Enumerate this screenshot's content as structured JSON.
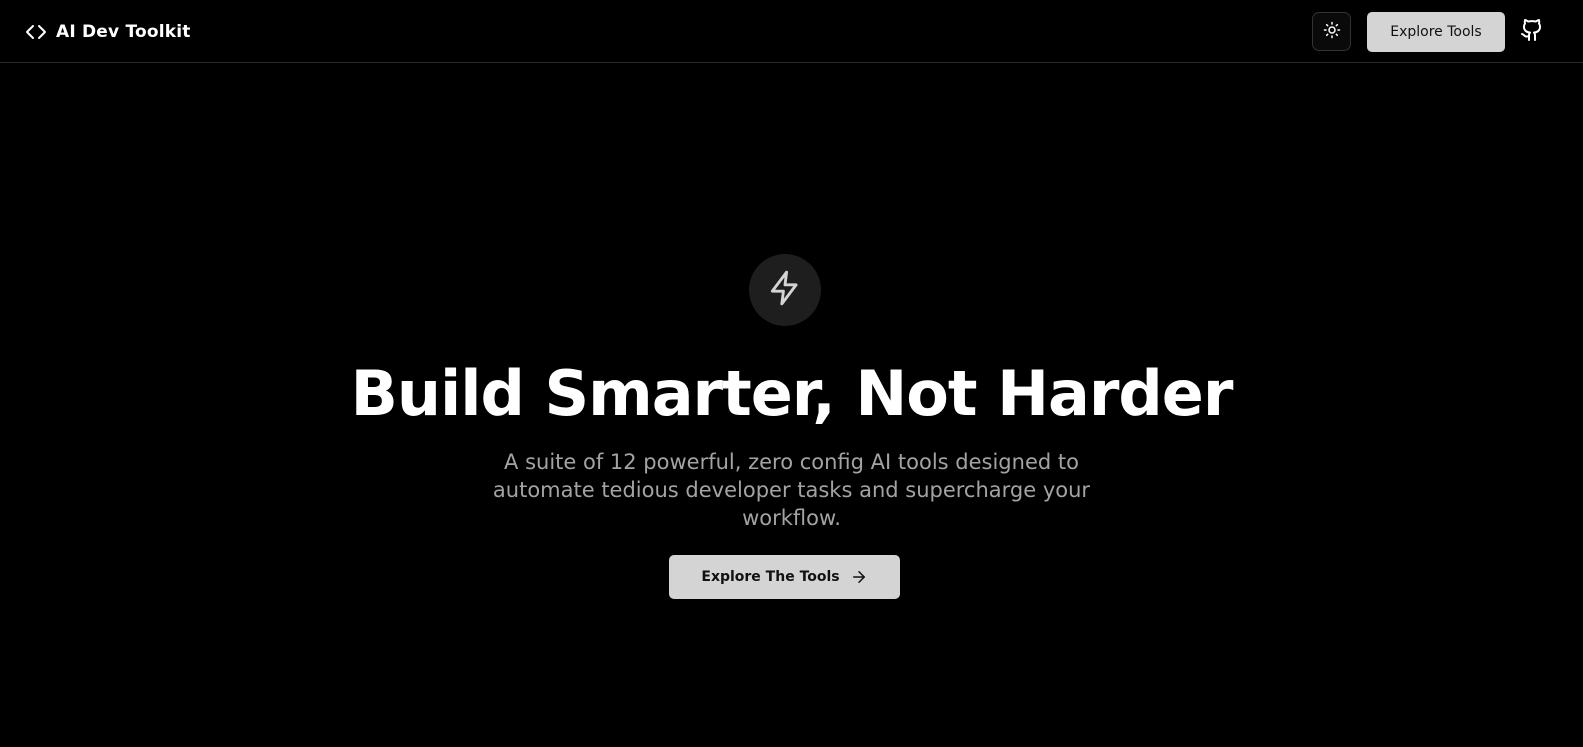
{
  "header": {
    "brand_name": "AI Dev Toolkit",
    "brand_icon": "code-icon",
    "theme_toggle_icon": "sun-icon",
    "nav_cta_label": "Explore Tools",
    "github_icon": "github-icon"
  },
  "hero": {
    "badge_icon": "lightning-bolt-icon",
    "title": "Build Smarter, Not Harder",
    "subtitle": "A suite of 12 powerful, zero config AI tools designed to automate tedious developer tasks and supercharge your workflow.",
    "cta_label": "Explore The Tools",
    "cta_icon": "arrow-right-icon"
  },
  "colors": {
    "background": "#000000",
    "button_bg": "#d4d4d4",
    "button_text": "#111111",
    "subtitle_text": "#a3a3a3",
    "badge_bg": "#1e1e1e",
    "border": "#2a2a2a"
  }
}
